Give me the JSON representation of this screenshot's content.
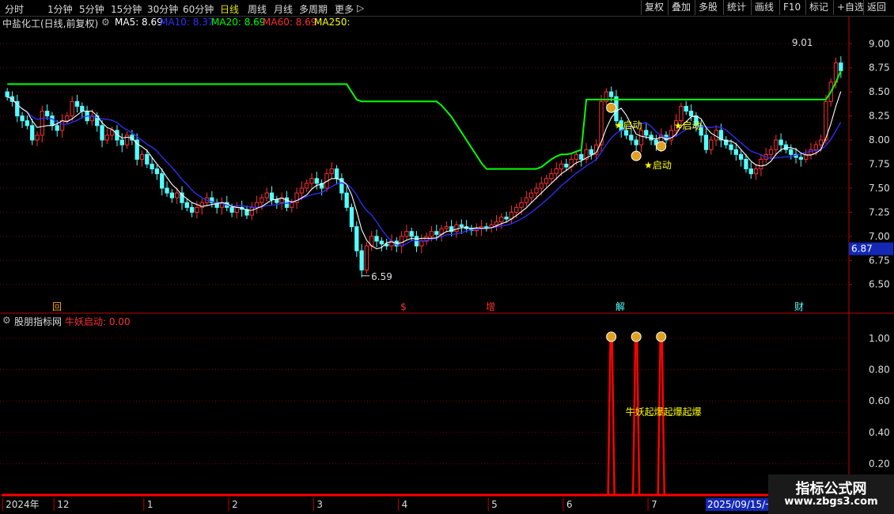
{
  "toolbar": {
    "periods": [
      "分时",
      "1分钟",
      "5分钟",
      "15分钟",
      "30分钟",
      "60分钟",
      "日线",
      "周线",
      "月线",
      "多周期",
      "更多"
    ],
    "active_period": "日线",
    "more_arrow": "▷",
    "right_buttons": [
      "复权",
      "叠加",
      "多股",
      "统计",
      "画线",
      "F10",
      "标记",
      "+自选",
      "返回"
    ]
  },
  "header": {
    "title": "中盐化工(日线,前复权)",
    "ma5": "MA5: 8.69",
    "ma10": "MA10: 8.37",
    "ma20": "MA20: 8.69",
    "ma60": "MA60: 8.69",
    "ma250": "MA250:"
  },
  "indicator": {
    "name": "股朋指标网",
    "label": "牛妖启动: 0.00",
    "text_label": "牛妖起爆起爆起爆",
    "y_ticks": [
      "1.00",
      "0.80",
      "0.60",
      "0.40",
      "0.20"
    ]
  },
  "markers": {
    "high_label": "9.01",
    "low_label": "6.59",
    "current_price": "6.87",
    "start_signal": "★启动",
    "event_flags": [
      "回",
      "$",
      "增",
      "解",
      "财"
    ]
  },
  "x_axis": {
    "labels": [
      "2024年",
      "12",
      "1",
      "2",
      "3",
      "4",
      "5",
      "6",
      "7",
      "8",
      "9"
    ],
    "cursor_date": "2025/09/15/一"
  },
  "watermark": {
    "line1": "指标公式网",
    "line2": "www.zbgs3.com"
  },
  "colors": {
    "up": "#ff3030",
    "down": "#54ffff",
    "ma5": "#ffffff",
    "ma10": "#3030ff",
    "ma20": "#00ff00",
    "ma60": "#ff3030",
    "ma250": "#ffff00",
    "axis": "#c00000"
  },
  "chart_data": {
    "type": "candlestick",
    "title": "中盐化工(日线,前复权)",
    "y_ticks": [
      9.0,
      8.75,
      8.5,
      8.25,
      8.0,
      7.75,
      7.5,
      7.25,
      7.0,
      6.75,
      6.5
    ],
    "ylim": [
      6.35,
      9.15
    ],
    "close_series": [
      8.45,
      8.4,
      8.25,
      8.2,
      8.15,
      8.0,
      8.05,
      8.3,
      8.25,
      8.15,
      8.1,
      8.2,
      8.25,
      8.4,
      8.35,
      8.3,
      8.2,
      8.25,
      8.15,
      8.0,
      8.05,
      8.1,
      8.0,
      7.95,
      8.05,
      8.0,
      7.8,
      7.85,
      7.75,
      7.7,
      7.65,
      7.5,
      7.45,
      7.4,
      7.45,
      7.35,
      7.3,
      7.25,
      7.3,
      7.35,
      7.4,
      7.35,
      7.3,
      7.35,
      7.3,
      7.25,
      7.3,
      7.28,
      7.22,
      7.3,
      7.35,
      7.4,
      7.45,
      7.38,
      7.35,
      7.4,
      7.3,
      7.35,
      7.45,
      7.5,
      7.55,
      7.6,
      7.55,
      7.5,
      7.65,
      7.7,
      7.6,
      7.45,
      7.3,
      7.1,
      6.85,
      6.65,
      6.9,
      7.0,
      6.95,
      6.92,
      6.9,
      6.95,
      6.9,
      7.0,
      7.05,
      7.0,
      6.9,
      6.95,
      7.0,
      7.05,
      7.02,
      7.08,
      7.1,
      7.05,
      7.12,
      7.1,
      7.08,
      7.06,
      7.08,
      7.1,
      7.09,
      7.12,
      7.15,
      7.2,
      7.18,
      7.25,
      7.3,
      7.35,
      7.4,
      7.45,
      7.5,
      7.55,
      7.6,
      7.65,
      7.7,
      7.75,
      7.72,
      7.8,
      7.85,
      7.8,
      7.9,
      7.85,
      7.95,
      8.4,
      8.5,
      8.45,
      8.2,
      8.1,
      8.05,
      8.0,
      7.95,
      8.1,
      8.05,
      8.0,
      7.95,
      8.05,
      8.0,
      8.1,
      8.2,
      8.35,
      8.3,
      8.25,
      8.15,
      8.05,
      7.9,
      8.0,
      8.1,
      8.0,
      7.95,
      7.9,
      7.85,
      7.8,
      7.7,
      7.65,
      7.7,
      7.8,
      7.85,
      7.9,
      8.0,
      7.95,
      7.9,
      7.85,
      7.82,
      7.8,
      7.85,
      7.9,
      7.95,
      8.0,
      8.4,
      8.6,
      8.8,
      8.72
    ],
    "ma20_series": [
      8.58,
      8.58,
      8.58,
      8.58,
      8.58,
      8.58,
      8.58,
      8.58,
      8.58,
      8.58,
      8.58,
      8.58,
      8.58,
      8.58,
      8.58,
      8.58,
      8.58,
      8.58,
      8.58,
      8.58,
      8.58,
      8.58,
      8.58,
      8.58,
      8.58,
      8.58,
      8.58,
      8.58,
      8.58,
      8.58,
      8.58,
      8.58,
      8.58,
      8.58,
      8.58,
      8.58,
      8.58,
      8.58,
      8.58,
      8.58,
      8.58,
      8.58,
      8.58,
      8.58,
      8.58,
      8.58,
      8.58,
      8.58,
      8.58,
      8.58,
      8.58,
      8.58,
      8.58,
      8.58,
      8.58,
      8.58,
      8.58,
      8.58,
      8.58,
      8.58,
      8.58,
      8.58,
      8.58,
      8.58,
      8.58,
      8.58,
      8.58,
      8.58,
      8.58,
      8.5,
      8.42,
      8.4,
      8.4,
      8.4,
      8.4,
      8.4,
      8.4,
      8.4,
      8.4,
      8.4,
      8.4,
      8.4,
      8.4,
      8.4,
      8.4,
      8.4,
      8.4,
      8.36,
      8.3,
      8.24,
      8.16,
      8.08,
      8.0,
      7.92,
      7.84,
      7.76,
      7.7,
      7.7,
      7.7,
      7.7,
      7.7,
      7.7,
      7.7,
      7.7,
      7.7,
      7.7,
      7.7,
      7.72,
      7.76,
      7.8,
      7.83,
      7.85,
      7.85,
      7.86,
      7.88,
      7.9,
      8.42,
      8.42,
      8.42,
      8.42,
      8.42,
      8.42,
      8.42,
      8.42,
      8.42,
      8.42,
      8.42,
      8.42,
      8.42,
      8.42,
      8.42,
      8.42,
      8.42,
      8.42,
      8.42,
      8.42,
      8.42,
      8.42,
      8.42,
      8.42,
      8.42,
      8.42,
      8.42,
      8.42,
      8.42,
      8.42,
      8.42,
      8.42,
      8.42,
      8.42,
      8.42,
      8.42,
      8.42,
      8.42,
      8.42,
      8.42,
      8.42,
      8.42,
      8.42,
      8.42,
      8.42,
      8.42,
      8.42,
      8.42,
      8.42,
      8.5,
      8.6,
      8.72
    ],
    "signal_indices": [
      121,
      126,
      131
    ],
    "indicator": {
      "name": "牛妖启动",
      "last_value": 0.0,
      "ylim": [
        0,
        1.05
      ],
      "spikes": [
        1,
        1,
        1
      ]
    }
  }
}
